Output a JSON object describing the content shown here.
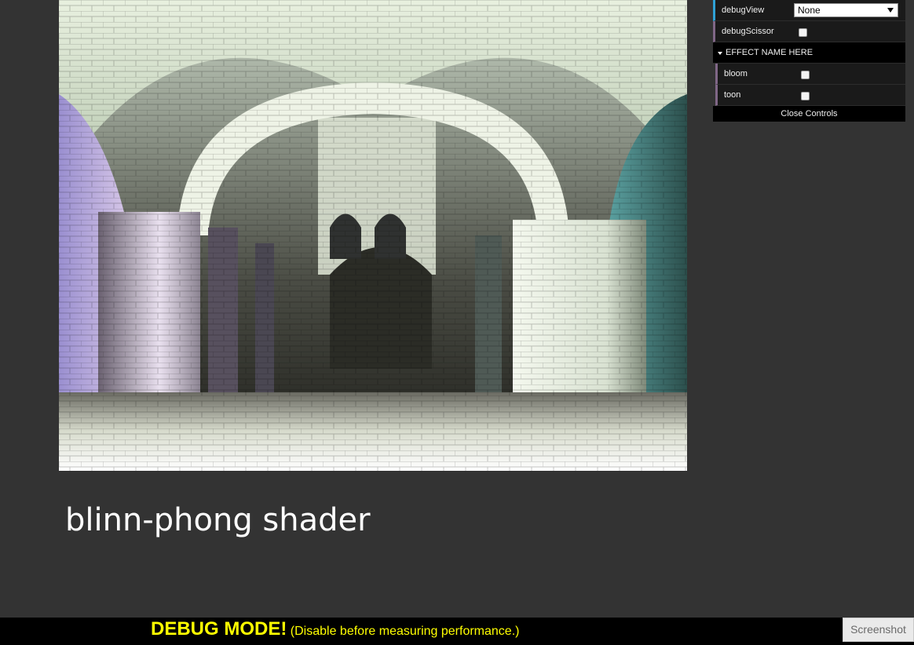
{
  "render": {
    "scene": "sponza-atrium",
    "caption": "blinn-phong shader"
  },
  "gui": {
    "debug_view": {
      "label": "debugView",
      "value": "None"
    },
    "debug_scissor": {
      "label": "debugScissor",
      "checked": false
    },
    "folder": {
      "title": "EFFECT NAME HERE",
      "items": [
        {
          "label": "bloom",
          "checked": false
        },
        {
          "label": "toon",
          "checked": false
        }
      ]
    },
    "close_label": "Close Controls"
  },
  "debug_bar": {
    "strong": "DEBUG MODE!",
    "sub": " (Disable before measuring performance.)",
    "color": "#ffff00"
  },
  "screenshot_label": "Screenshot",
  "icons": {
    "folder_toggle": "triangle-down-icon",
    "select_arrow": "caret-down-icon"
  }
}
